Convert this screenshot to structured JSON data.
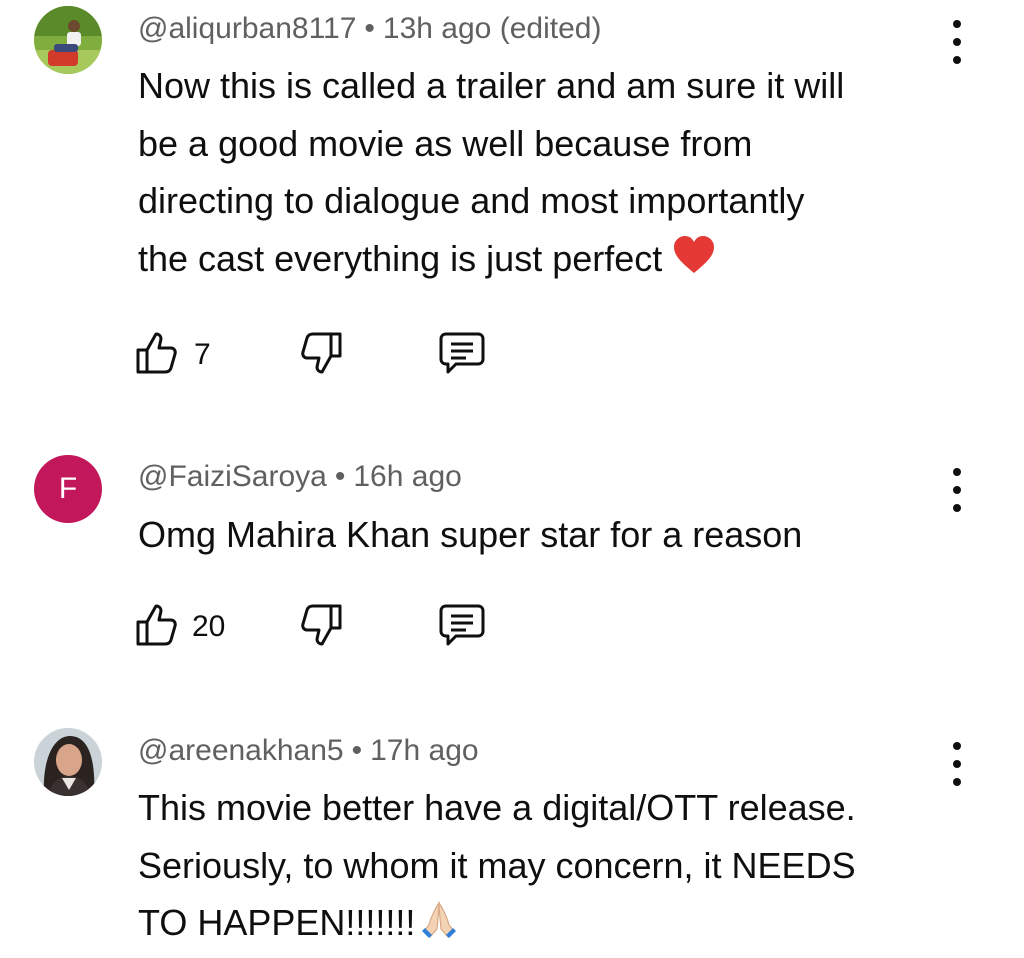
{
  "comments": [
    {
      "author": "@aliqurban8117",
      "time": "13h ago",
      "edited": "(edited)",
      "separator": "•",
      "lines": [
        "Now this is called a trailer and am sure it will",
        "be a good movie as well because from",
        "directing to dialogue and most importantly",
        "the cast everything is just perfect"
      ],
      "emoji": "red-heart",
      "likes": "7",
      "avatar": "photo"
    },
    {
      "author": "@FaiziSaroya",
      "time": "16h ago",
      "separator": "•",
      "lines": [
        "Omg Mahira Khan super star for a reason"
      ],
      "likes": "20",
      "avatar_letter": "F",
      "avatar_color": "#c2185b"
    },
    {
      "author": "@areenakhan5",
      "time": "17h ago",
      "separator": "•",
      "lines": [
        "This movie better have a digital/OTT release.",
        "Seriously, to whom it may concern, it NEEDS",
        "TO HAPPEN!!!!!!!"
      ],
      "emoji": "folded-hands",
      "avatar": "photo"
    }
  ],
  "icons": {
    "like": "thumbs-up-icon",
    "dislike": "thumbs-down-icon",
    "reply": "reply-comment-icon",
    "menu": "more-vertical-icon"
  }
}
